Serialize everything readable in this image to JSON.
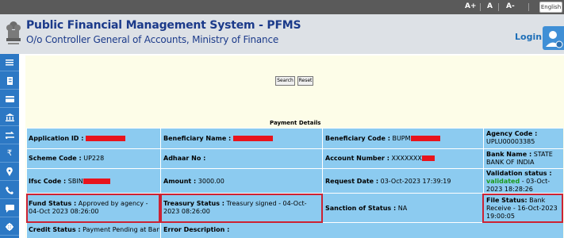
{
  "topbar": {
    "font_increase": "A+",
    "font_normal": "A",
    "font_decrease": "A-",
    "language": "English"
  },
  "header": {
    "title": "Public Financial Management System - PFMS",
    "subtitle": "O/o Controller General of Accounts, Ministry of Finance",
    "login_label": "Login",
    "emblem_icon": "state-emblem-icon"
  },
  "sidebar": {
    "icons": [
      "menu-icon",
      "building-icon",
      "card-icon",
      "bank-icon",
      "transfer-icon",
      "rupee-icon",
      "location-icon",
      "phone-icon",
      "chat-icon",
      "gear-icon"
    ]
  },
  "form": {
    "search_label": "Search",
    "reset_label": "Reset"
  },
  "payment_details": {
    "title": "Payment Details",
    "application_id_label": "Application ID :",
    "application_id_value": "",
    "beneficiary_name_label": "Beneficiary Name :",
    "beneficiary_code_label": "Beneficiary Code :",
    "beneficiary_code_value": "BUPM",
    "agency_code_label": "Agency Code :",
    "agency_code_value": "UPLU00003385",
    "scheme_code_label": "Scheme Code :",
    "scheme_code_value": "UP228",
    "adhaar_label": "Adhaar No :",
    "account_number_label": "Account Number :",
    "account_number_value": "XXXXXXX",
    "bank_name_label": "Bank Name :",
    "bank_name_value": "STATE BANK OF INDIA",
    "ifsc_label": "Ifsc Code :",
    "ifsc_value": "SBIN",
    "amount_label": "Amount :",
    "amount_value": "3000.00",
    "request_date_label": "Request Date :",
    "request_date_value": "03-Oct-2023 17:39:19",
    "validation_label": "Validation status :",
    "validation_value": "validated",
    "validation_date": "- 03-Oct-2023 18:28:26",
    "fund_status_label": "Fund Status :",
    "fund_status_value": "Approved by agency - 04-Oct 2023 08:26:00",
    "treasury_status_label": "Treasury Status :",
    "treasury_status_value": "Treasury signed - 04-Oct-2023 08:26:00",
    "sanction_label": "Sanction of Status :",
    "sanction_value": "NA",
    "file_status_label": "File Status:",
    "file_status_value": "Bank Receive - 16-Oct-2023 19:00:05",
    "credit_status_label": "Credit Status :",
    "credit_status_value": "Payment Pending at Bank",
    "error_label": "Error Description :",
    "error_value": ""
  },
  "colors": {
    "header_blue": "#1b3a8a",
    "sidebar_blue": "#2c78c4",
    "table_bg": "#8ccbf0",
    "validated_green": "#1a9a1a",
    "highlight_red": "#cc2233"
  }
}
